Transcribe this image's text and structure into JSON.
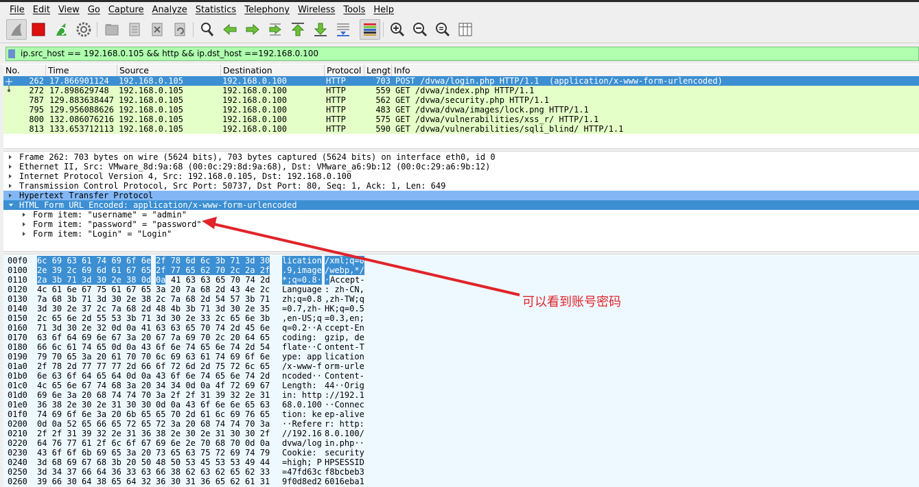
{
  "menu": [
    "File",
    "Edit",
    "View",
    "Go",
    "Capture",
    "Analyze",
    "Statistics",
    "Telephony",
    "Wireless",
    "Tools",
    "Help"
  ],
  "toolbar": {
    "start": "shark-fin-icon",
    "stop": "stop-icon",
    "restart": "restart-capture-icon",
    "options": "gear-icon",
    "open": "open-file-icon",
    "save": "save-file-icon",
    "close": "close-file-icon",
    "reload": "reload-icon",
    "find": "find-icon",
    "back": "go-back-icon",
    "forward": "go-forward-icon",
    "goto": "go-to-packet-icon",
    "first": "first-packet-icon",
    "last": "last-packet-icon",
    "autoscroll": "auto-scroll-icon",
    "colorize": "colorize-icon",
    "zoom_in": "zoom-in-icon",
    "zoom_out": "zoom-out-icon",
    "zoom_normal": "zoom-normal-icon",
    "resize_columns": "resize-columns-icon"
  },
  "colors": {
    "accent": "#3c8fd2",
    "http_row": "#e4ffc7",
    "filter_ok": "#afffaf",
    "annotation": "#e0242a",
    "highlight_light": "#82b7f5"
  },
  "filter": {
    "value": "ip.src_host == 192.168.0.105 && http && ip.dst_host ==192.168.0.100"
  },
  "packet_list": {
    "columns": [
      "No.",
      "Time",
      "Source",
      "Destination",
      "Protocol",
      "Length",
      "Info"
    ],
    "rows": [
      {
        "no": "262",
        "time": "17.866901124",
        "src": "192.168.0.105",
        "dst": "192.168.0.100",
        "proto": "HTTP",
        "len": "703",
        "info": "POST /dvwa/login.php HTTP/1.1  (application/x-www-form-urlencoded)"
      },
      {
        "no": "272",
        "time": "17.898629748",
        "src": "192.168.0.105",
        "dst": "192.168.0.100",
        "proto": "HTTP",
        "len": "559",
        "info": "GET /dvwa/index.php HTTP/1.1"
      },
      {
        "no": "787",
        "time": "129.883638447",
        "src": "192.168.0.105",
        "dst": "192.168.0.100",
        "proto": "HTTP",
        "len": "562",
        "info": "GET /dvwa/security.php HTTP/1.1"
      },
      {
        "no": "795",
        "time": "129.956088626",
        "src": "192.168.0.105",
        "dst": "192.168.0.100",
        "proto": "HTTP",
        "len": "483",
        "info": "GET /dvwa/dvwa/images/lock.png HTTP/1.1"
      },
      {
        "no": "800",
        "time": "132.086076216",
        "src": "192.168.0.105",
        "dst": "192.168.0.100",
        "proto": "HTTP",
        "len": "575",
        "info": "GET /dvwa/vulnerabilities/xss_r/ HTTP/1.1"
      },
      {
        "no": "813",
        "time": "133.653712113",
        "src": "192.168.0.105",
        "dst": "192.168.0.100",
        "proto": "HTTP",
        "len": "590",
        "info": "GET /dvwa/vulnerabilities/sqli_blind/ HTTP/1.1"
      }
    ]
  },
  "details": [
    {
      "text": "Frame 262: 703 bytes on wire (5624 bits), 703 bytes captured (5624 bits) on interface eth0, id 0",
      "state": "collapsed",
      "style": "",
      "indent": 0
    },
    {
      "text": "Ethernet II, Src: VMware_8d:9a:68 (00:0c:29:8d:9a:68), Dst: VMware_a6:9b:12 (00:0c:29:a6:9b:12)",
      "state": "collapsed",
      "style": "",
      "indent": 0
    },
    {
      "text": "Internet Protocol Version 4, Src: 192.168.0.105, Dst: 192.168.0.100",
      "state": "collapsed",
      "style": "",
      "indent": 0
    },
    {
      "text": "Transmission Control Protocol, Src Port: 50737, Dst Port: 80, Seq: 1, Ack: 1, Len: 649",
      "state": "collapsed",
      "style": "",
      "indent": 0
    },
    {
      "text": "Hypertext Transfer Protocol",
      "state": "collapsed",
      "style": "light",
      "indent": 0
    },
    {
      "text": "HTML Form URL Encoded: application/x-www-form-urlencoded",
      "state": "expanded",
      "style": "sel",
      "indent": 0
    },
    {
      "text": "Form item: \"username\" = \"admin\"",
      "state": "collapsed",
      "style": "",
      "indent": 1
    },
    {
      "text": "Form item: \"password\" = \"password\"",
      "state": "collapsed",
      "style": "",
      "indent": 1
    },
    {
      "text": "Form item: \"Login\" = \"Login\"",
      "state": "collapsed",
      "style": "",
      "indent": 1
    }
  ],
  "bytes": [
    {
      "off": "00f0",
      "h1": "6c 69 63 61 74 69 6f 6e",
      "h2": "2f 78 6d 6c 3b 71 3d 30",
      "a1": "lication",
      "a2": "/xml;q=0"
    },
    {
      "off": "0100",
      "h1": "2e 39 2c 69 6d 61 67 65",
      "h2": "2f 77 65 62 70 2c 2a 2f",
      "a1": ".9,image",
      "a2": "/webp,*/"
    },
    {
      "off": "0110",
      "h1": "2a 3b 71 3d 30 2e 38 0d",
      "h2": "0a 41 63 63 65 70 74 2d",
      "a1": "*;q=0.8·",
      "a2": "·Accept-"
    },
    {
      "off": "0120",
      "h1": "4c 61 6e 67 75 61 67 65",
      "h2": "3a 20 7a 68 2d 43 4e 2c",
      "a1": "Language",
      "a2": ": zh-CN,"
    },
    {
      "off": "0130",
      "h1": "7a 68 3b 71 3d 30 2e 38",
      "h2": "2c 7a 68 2d 54 57 3b 71",
      "a1": "zh;q=0.8",
      "a2": ",zh-TW;q"
    },
    {
      "off": "0140",
      "h1": "3d 30 2e 37 2c 7a 68 2d",
      "h2": "48 4b 3b 71 3d 30 2e 35",
      "a1": "=0.7,zh-",
      "a2": "HK;q=0.5"
    },
    {
      "off": "0150",
      "h1": "2c 65 6e 2d 55 53 3b 71",
      "h2": "3d 30 2e 33 2c 65 6e 3b",
      "a1": ",en-US;q",
      "a2": "=0.3,en;"
    },
    {
      "off": "0160",
      "h1": "71 3d 30 2e 32 0d 0a 41",
      "h2": "63 63 65 70 74 2d 45 6e",
      "a1": "q=0.2··A",
      "a2": "ccept-En"
    },
    {
      "off": "0170",
      "h1": "63 6f 64 69 6e 67 3a 20",
      "h2": "67 7a 69 70 2c 20 64 65",
      "a1": "coding: ",
      "a2": "gzip, de"
    },
    {
      "off": "0180",
      "h1": "66 6c 61 74 65 0d 0a 43",
      "h2": "6f 6e 74 65 6e 74 2d 54",
      "a1": "flate··C",
      "a2": "ontent-T"
    },
    {
      "off": "0190",
      "h1": "79 70 65 3a 20 61 70 70",
      "h2": "6c 69 63 61 74 69 6f 6e",
      "a1": "ype: app",
      "a2": "lication"
    },
    {
      "off": "01a0",
      "h1": "2f 78 2d 77 77 77 2d 66",
      "h2": "6f 72 6d 2d 75 72 6c 65",
      "a1": "/x-www-f",
      "a2": "orm-urle"
    },
    {
      "off": "01b0",
      "h1": "6e 63 6f 64 65 64 0d 0a",
      "h2": "43 6f 6e 74 65 6e 74 2d",
      "a1": "ncoded··",
      "a2": "Content-"
    },
    {
      "off": "01c0",
      "h1": "4c 65 6e 67 74 68 3a 20",
      "h2": "34 34 0d 0a 4f 72 69 67",
      "a1": "Length: ",
      "a2": "44··Orig"
    },
    {
      "off": "01d0",
      "h1": "69 6e 3a 20 68 74 74 70",
      "h2": "3a 2f 2f 31 39 32 2e 31",
      "a1": "in: http",
      "a2": "://192.1"
    },
    {
      "off": "01e0",
      "h1": "36 38 2e 30 2e 31 30 30",
      "h2": "0d 0a 43 6f 6e 6e 65 63",
      "a1": "68.0.100",
      "a2": "··Connec"
    },
    {
      "off": "01f0",
      "h1": "74 69 6f 6e 3a 20 6b 65",
      "h2": "65 70 2d 61 6c 69 76 65",
      "a1": "tion: ke",
      "a2": "ep-alive"
    },
    {
      "off": "0200",
      "h1": "0d 0a 52 65 66 65 72 65",
      "h2": "72 3a 20 68 74 74 70 3a",
      "a1": "··Refere",
      "a2": "r: http:"
    },
    {
      "off": "0210",
      "h1": "2f 2f 31 39 32 2e 31 36",
      "h2": "38 2e 30 2e 31 30 30 2f",
      "a1": "//192.16",
      "a2": "8.0.100/"
    },
    {
      "off": "0220",
      "h1": "64 76 77 61 2f 6c 6f 67",
      "h2": "69 6e 2e 70 68 70 0d 0a",
      "a1": "dvwa/log",
      "a2": "in.php··"
    },
    {
      "off": "0230",
      "h1": "43 6f 6f 6b 69 65 3a 20",
      "h2": "73 65 63 75 72 69 74 79",
      "a1": "Cookie: ",
      "a2": "security"
    },
    {
      "off": "0240",
      "h1": "3d 68 69 67 68 3b 20 50",
      "h2": "48 50 53 45 53 53 49 44",
      "a1": "=high; P",
      "a2": "HPSESSID"
    },
    {
      "off": "0250",
      "h1": "3d 34 37 66 64 36 33 63",
      "h2": "66 38 62 63 62 65 62 33",
      "a1": "=47fd63c",
      "a2": "f8bcbeb3"
    },
    {
      "off": "0260",
      "h1": "39 66 30 64 38 65 64 32",
      "h2": "36 30 31 36 65 62 61 31",
      "a1": "9f0d8ed2",
      "a2": "6016eba1"
    }
  ],
  "annotation": {
    "text": "可以看到账号密码"
  }
}
